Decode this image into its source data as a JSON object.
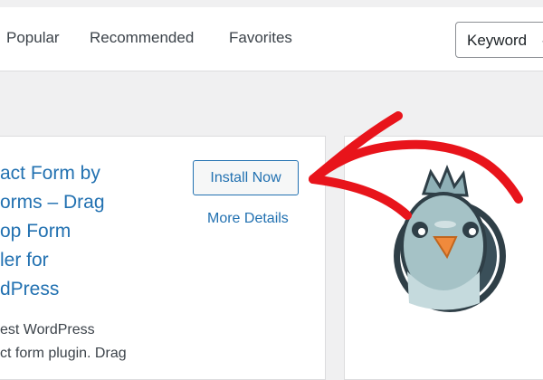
{
  "filter_tabs": [
    "Popular",
    "Recommended",
    "Favorites"
  ],
  "search": {
    "type_value": "Keyword"
  },
  "plugin": {
    "title_lines": [
      "act Form by",
      "orms – Drag",
      "op Form",
      "ler for",
      "dPress"
    ],
    "install_label": "Install Now",
    "details_label": "More Details",
    "description_lines": [
      "est WordPress",
      "ct form plugin. Drag"
    ]
  },
  "colors": {
    "link": "#2271b1",
    "annotation_arrow": "#e8141b",
    "page_background": "#f0f0f1"
  },
  "icons": {
    "plugin_icon": "pigeon-mascot-icon",
    "annotation": "red-arrow-icon",
    "select_chevron": "chevron-down-icon"
  }
}
